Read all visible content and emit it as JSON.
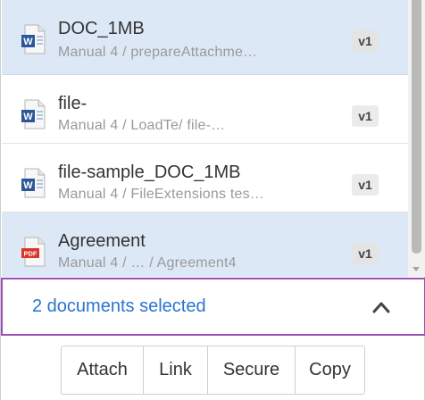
{
  "documents": [
    {
      "title": "DOC_1MB",
      "path": "Manual  4 / prepareAttachme…",
      "version": "v1",
      "icon": "word-document-icon",
      "selected": true
    },
    {
      "title": "file-",
      "path": "Manual  4 / LoadTe/ file-…",
      "version": "v1",
      "icon": "word-document-icon",
      "selected": false
    },
    {
      "title": "file-sample_DOC_1MB",
      "path": "Manual  4 / FileExtensions tes…",
      "version": "v1",
      "icon": "word-document-icon",
      "selected": false
    },
    {
      "title": "Agreement",
      "path": "Manual  4 / … / Agreement4",
      "version": "v1",
      "icon": "pdf-document-icon",
      "selected": true
    }
  ],
  "selection": {
    "label": "2 documents selected",
    "toggle_icon": "chevron-up-icon"
  },
  "actions": {
    "attach": "Attach",
    "link": "Link",
    "secure": "Secure",
    "copy": "Copy"
  },
  "colors": {
    "selected_row": "#dde8f7",
    "selection_text": "#2a73d1",
    "selection_border": "#9c4fb5",
    "word_blue": "#2b5797",
    "pdf_red": "#d9352a"
  },
  "pdf_badge": "PDF"
}
